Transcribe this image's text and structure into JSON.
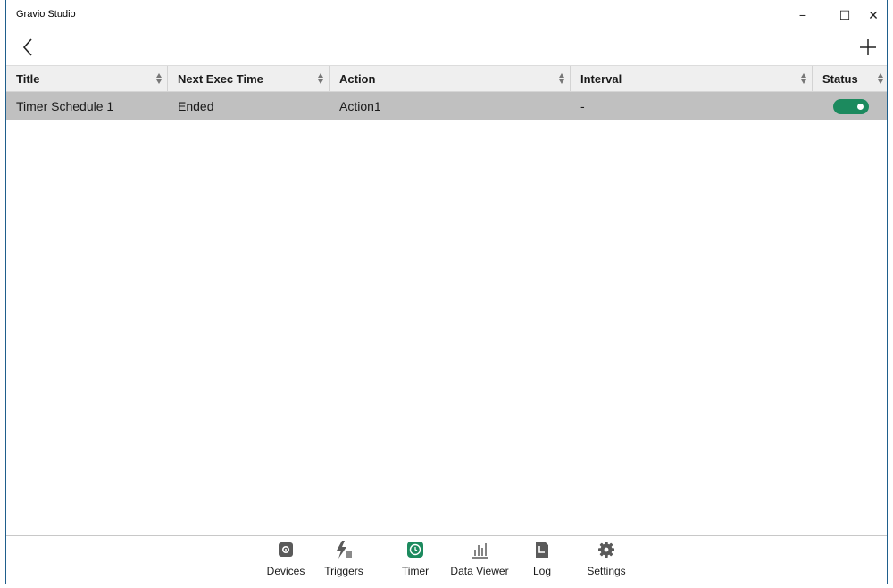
{
  "window": {
    "title": "Gravio Studio",
    "controls": {
      "minimize": "−",
      "maximize": "☐",
      "close": "✕"
    }
  },
  "toolbar": {
    "back_icon": "chevron-left-icon",
    "add_icon": "plus-icon"
  },
  "table": {
    "columns": [
      "Title",
      "Next Exec Time",
      "Action",
      "Interval",
      "Status"
    ],
    "rows": [
      {
        "title": "Timer Schedule 1",
        "next_exec_time": "Ended",
        "action": "Action1",
        "interval": "-",
        "status_on": true
      }
    ]
  },
  "bottom_nav": {
    "items": [
      {
        "label": "Devices",
        "icon": "devices-icon"
      },
      {
        "label": "Triggers",
        "icon": "triggers-icon"
      },
      {
        "label": "Timer",
        "icon": "timer-icon",
        "active": true
      },
      {
        "label": "Data Viewer",
        "icon": "chart-icon"
      },
      {
        "label": "Log",
        "icon": "log-icon"
      },
      {
        "label": "Settings",
        "icon": "gear-icon"
      }
    ]
  },
  "colors": {
    "accent": "#1c8a5e",
    "selected_row": "#c0c0c0",
    "header_bg": "#efefef",
    "icon_gray": "#5a5a5a"
  }
}
